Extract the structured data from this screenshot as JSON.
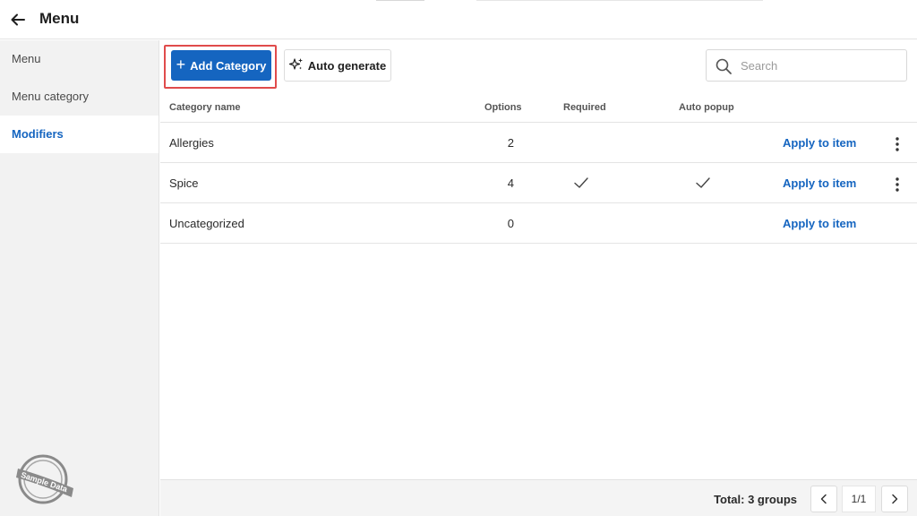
{
  "header": {
    "title": "Menu",
    "back_icon": "arrow-left-icon"
  },
  "sidebar": {
    "items": [
      {
        "label": "Menu",
        "active": false
      },
      {
        "label": "Menu category",
        "active": false
      },
      {
        "label": "Modifiers",
        "active": true
      }
    ],
    "stamp_text": "Sample Data"
  },
  "toolbar": {
    "add_label": "Add Category",
    "auto_label": "Auto generate",
    "search_placeholder": "Search",
    "search_value": ""
  },
  "table": {
    "columns": {
      "name": "Category name",
      "options": "Options",
      "required": "Required",
      "auto_popup": "Auto popup"
    },
    "rows": [
      {
        "name": "Allergies",
        "options": "2",
        "required": false,
        "auto_popup": false,
        "action": "Apply to item",
        "has_menu": true
      },
      {
        "name": "Spice",
        "options": "4",
        "required": true,
        "auto_popup": true,
        "action": "Apply to item",
        "has_menu": true
      },
      {
        "name": "Uncategorized",
        "options": "0",
        "required": false,
        "auto_popup": false,
        "action": "Apply to item",
        "has_menu": false
      }
    ]
  },
  "footer": {
    "total": "Total: 3 groups",
    "page": "1/1"
  },
  "colors": {
    "accent": "#1565c0",
    "highlight": "#e04b4b",
    "sidebar_bg": "#f2f2f2"
  }
}
